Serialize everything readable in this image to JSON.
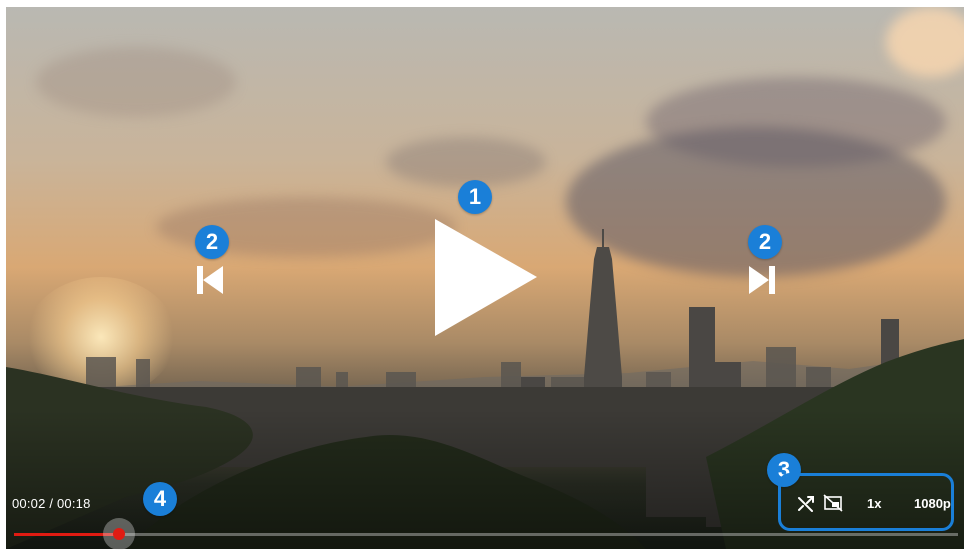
{
  "player": {
    "current_time": "00:02",
    "duration": "00:18",
    "time_display": "00:02 / 00:18",
    "progress_fraction": 0.111,
    "speed": "1x",
    "quality": "1080p",
    "accent_color": "#e01b12",
    "annotation_color": "#1a7fd8"
  },
  "controls": {
    "play_icon": "play-icon",
    "previous_icon": "skip-previous-icon",
    "next_icon": "skip-next-icon",
    "shuffle_icon": "shuffle-icon",
    "pip_icon": "picture-in-picture-off-icon"
  },
  "annotations": {
    "play": "1",
    "prev": "2",
    "next": "2",
    "settings": "3",
    "timeline": "4"
  }
}
